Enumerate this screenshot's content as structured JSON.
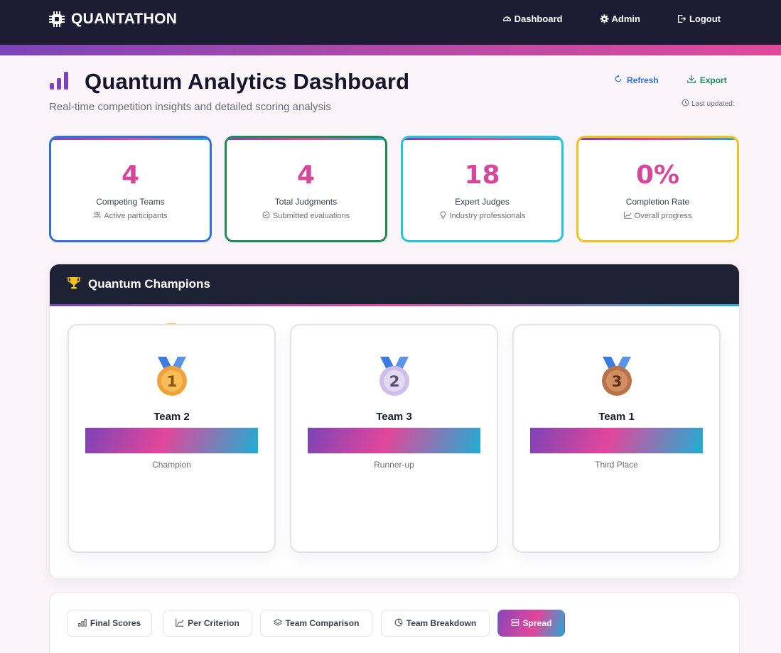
{
  "nav": {
    "brand": "QUANTATHON",
    "links": [
      {
        "label": "Dashboard",
        "icon": "gauge-icon"
      },
      {
        "label": "Admin",
        "icon": "gear-icon"
      },
      {
        "label": "Logout",
        "icon": "logout-icon"
      }
    ]
  },
  "header": {
    "title": "Quantum Analytics Dashboard",
    "subtitle": "Real-time competition insights and detailed scoring analysis",
    "refresh_label": "Refresh",
    "export_label": "Export",
    "last_updated_label": "Last updated:"
  },
  "stats": [
    {
      "value": "4",
      "label": "Competing Teams",
      "sub": "Active participants",
      "border": "#2f6fe0"
    },
    {
      "value": "4",
      "label": "Total Judgments",
      "sub": "Submitted evaluations",
      "border": "#1f8a52"
    },
    {
      "value": "18",
      "label": "Expert Judges",
      "sub": "Industry professionals",
      "border": "#22c4e0"
    },
    {
      "value": "0%",
      "label": "Completion Rate",
      "sub": "Overall progress",
      "border": "#f2c21a"
    }
  ],
  "champions": {
    "title": "Quantum Champions",
    "podium": [
      {
        "rank": "1",
        "team": "Team 2",
        "place": "Champion",
        "medal_color": "#f0a23a"
      },
      {
        "rank": "2",
        "team": "Team 3",
        "place": "Runner-up",
        "medal_color": "#d6cbea"
      },
      {
        "rank": "3",
        "team": "Team 1",
        "place": "Third Place",
        "medal_color": "#c7845a"
      }
    ]
  },
  "tabs": [
    {
      "label": "Final Scores",
      "icon": "bar-chart-icon"
    },
    {
      "label": "Per Criterion",
      "icon": "line-chart-icon"
    },
    {
      "label": "Team Comparison",
      "icon": "layers-icon"
    },
    {
      "label": "Team Breakdown",
      "icon": "pie-chart-icon"
    },
    {
      "label": "Spread",
      "icon": "spread-icon",
      "active": true
    }
  ],
  "colors": {
    "nav_bg": "#1e1b35",
    "accent_pink": "#d5479a",
    "accent_purple": "#7b44b8",
    "accent_cyan": "#25a9d2"
  }
}
